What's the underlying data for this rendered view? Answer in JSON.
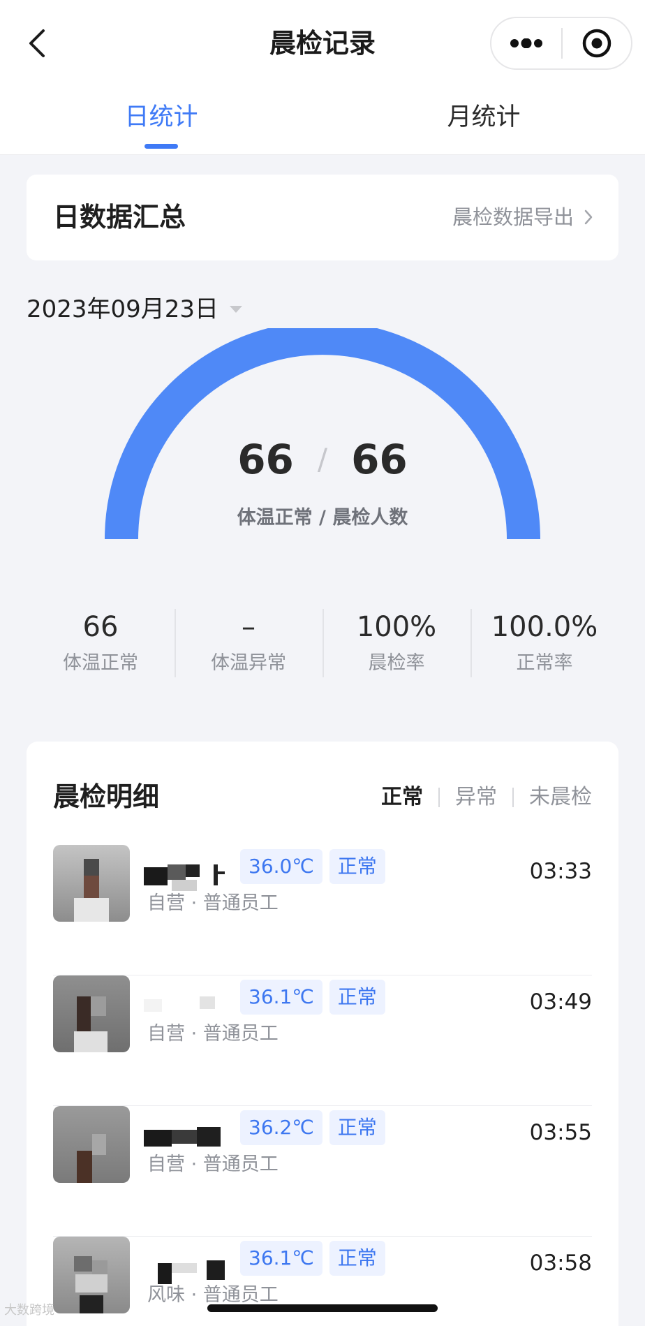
{
  "header": {
    "title": "晨检记录",
    "back_icon": "chevron-left-icon",
    "more_icon": "more-dots-icon",
    "close_icon": "target-close-icon"
  },
  "tabs": [
    {
      "label": "日统计",
      "active": true
    },
    {
      "label": "月统计",
      "active": false
    }
  ],
  "summary": {
    "title": "日数据汇总",
    "export_label": "晨检数据导出"
  },
  "date": {
    "value": "2023年09月23日"
  },
  "gauge": {
    "normal": "66",
    "total": "66",
    "separator": "/",
    "caption": "体温正常 / 晨检人数",
    "fill_fraction": 1.0
  },
  "stats": [
    {
      "value": "66",
      "label": "体温正常"
    },
    {
      "value": "–",
      "label": "体温异常"
    },
    {
      "value": "100%",
      "label": "晨检率"
    },
    {
      "value": "100.0%",
      "label": "正常率"
    }
  ],
  "details": {
    "title": "晨检明细",
    "filters": [
      {
        "label": "正常",
        "active": true
      },
      {
        "label": "异常",
        "active": false
      },
      {
        "label": "未晨检",
        "active": false
      }
    ],
    "records": [
      {
        "temp": "36.0℃",
        "status": "正常",
        "meta": "自营 · 普通员工",
        "time": "03:33"
      },
      {
        "temp": "36.1℃",
        "status": "正常",
        "meta": "自营 · 普通员工",
        "time": "03:49"
      },
      {
        "temp": "36.2℃",
        "status": "正常",
        "meta": "自营 · 普通员工",
        "time": "03:55"
      },
      {
        "temp": "36.1℃",
        "status": "正常",
        "meta": "风味 · 普通员工",
        "time": "03:58"
      }
    ]
  },
  "watermark": "大数跨境",
  "colors": {
    "accent": "#3f7af6",
    "gauge": "#4f89f7",
    "badge_bg": "#edf2ff",
    "muted_text": "#8f9299"
  }
}
